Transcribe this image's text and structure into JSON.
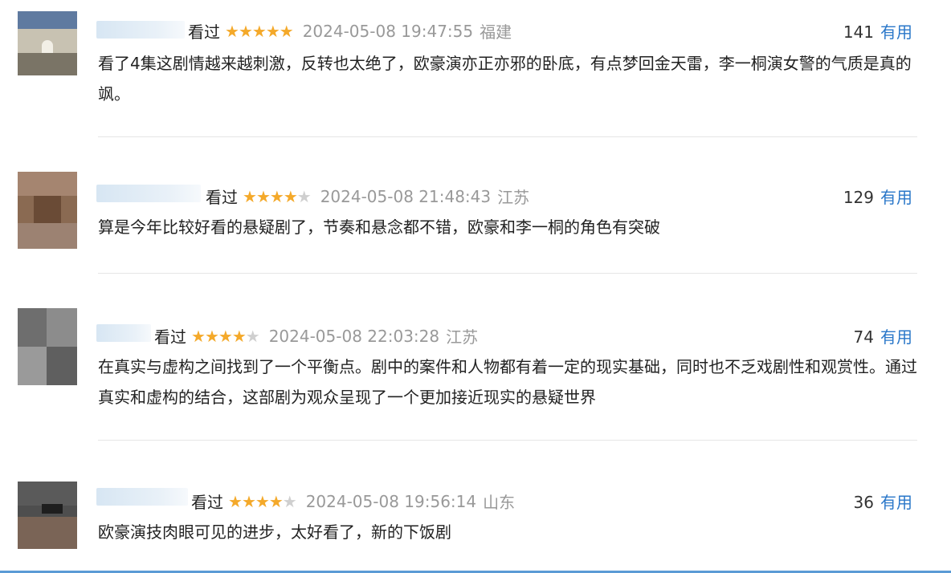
{
  "reviews": [
    {
      "watched": "看过",
      "rating": 5,
      "time": "2024-05-08 19:47:55",
      "location": "福建",
      "useful_count": "141",
      "useful_label": "有用",
      "text": "看了4集这剧情越来越刺激，反转也太绝了，欧豪演亦正亦邪的卧底，有点梦回金天雷，李一桐演女警的气质是真的飒。"
    },
    {
      "watched": "看过",
      "rating": 4,
      "time": "2024-05-08 21:48:43",
      "location": "江苏",
      "useful_count": "129",
      "useful_label": "有用",
      "text": "算是今年比较好看的悬疑剧了，节奏和悬念都不错，欧豪和李一桐的角色有突破"
    },
    {
      "watched": "看过",
      "rating": 4,
      "time": "2024-05-08 22:03:28",
      "location": "江苏",
      "useful_count": "74",
      "useful_label": "有用",
      "text": "在真实与虚构之间找到了一个平衡点。剧中的案件和人物都有着一定的现实基础，同时也不乏戏剧性和观赏性。通过真实和虚构的结合，这部剧为观众呈现了一个更加接近现实的悬疑世界"
    },
    {
      "watched": "看过",
      "rating": 4,
      "time": "2024-05-08 19:56:14",
      "location": "山东",
      "useful_count": "36",
      "useful_label": "有用",
      "text": "欧豪演技肉眼可见的进步，太好看了，新的下饭剧"
    }
  ],
  "colors": {
    "star_on": "#f4a92a",
    "star_off": "#cfcfcf",
    "useful_link": "#2a77c9",
    "meta_gray": "#999999"
  },
  "icons": {
    "star": "star-icon"
  }
}
